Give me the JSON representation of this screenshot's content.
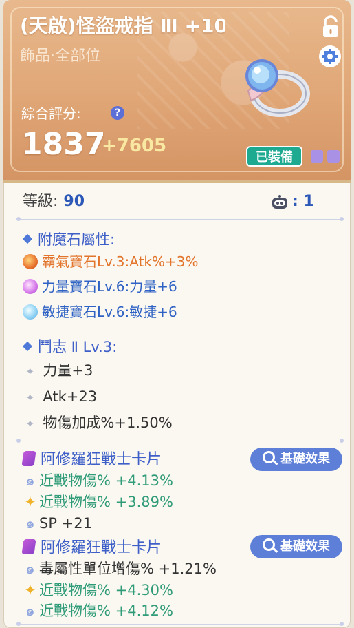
{
  "item": {
    "name": "(天啟)怪盜戒指 Ⅲ +10",
    "slot": "飾品‧全部位",
    "score_label": "綜合評分:",
    "score_help": "?",
    "score": "1837",
    "score_bonus": "+7605",
    "equipped_label": "已裝備"
  },
  "level": {
    "label": "等級:",
    "value": "90",
    "robot_value": ": 1"
  },
  "enchant": {
    "title": "附魔石屬性:",
    "gems": [
      {
        "text": "霸氣寶石Lv.3:Atk%+3%",
        "color": "#e2742b",
        "icon": "red-gem-icon"
      },
      {
        "text": "力量寶石Lv.6:力量+6",
        "color": "#2f62c4",
        "icon": "pink-gem-icon"
      },
      {
        "text": "敏捷寶石Lv.6:敏捷+6",
        "color": "#2f62c4",
        "icon": "blue-gem-icon"
      }
    ]
  },
  "spirit": {
    "title": "鬥志 Ⅱ Lv.3:",
    "stats": [
      "力量+3",
      "Atk+23",
      "物傷加成%+1.50%"
    ]
  },
  "cards": [
    {
      "name": "阿修羅狂戰士卡片",
      "button": "基礎效果",
      "effects": [
        {
          "text": "近戰物傷% +4.13%",
          "icon": "swirl",
          "color": "#2f9b78"
        },
        {
          "text": "近戰物傷% +3.89%",
          "icon": "spark",
          "color": "#2f9b78"
        },
        {
          "text": "SP +21",
          "icon": "swirl",
          "color": "#333333"
        }
      ]
    },
    {
      "name": "阿修羅狂戰士卡片",
      "button": "基礎效果",
      "effects": [
        {
          "text": "毒屬性單位增傷% +1.21%",
          "icon": "swirl",
          "color": "#333333"
        },
        {
          "text": "近戰物傷% +4.30%",
          "icon": "spark",
          "color": "#2f9b78"
        },
        {
          "text": "近戰物傷% +4.12%",
          "icon": "swirl",
          "color": "#2f9b78"
        }
      ]
    }
  ]
}
